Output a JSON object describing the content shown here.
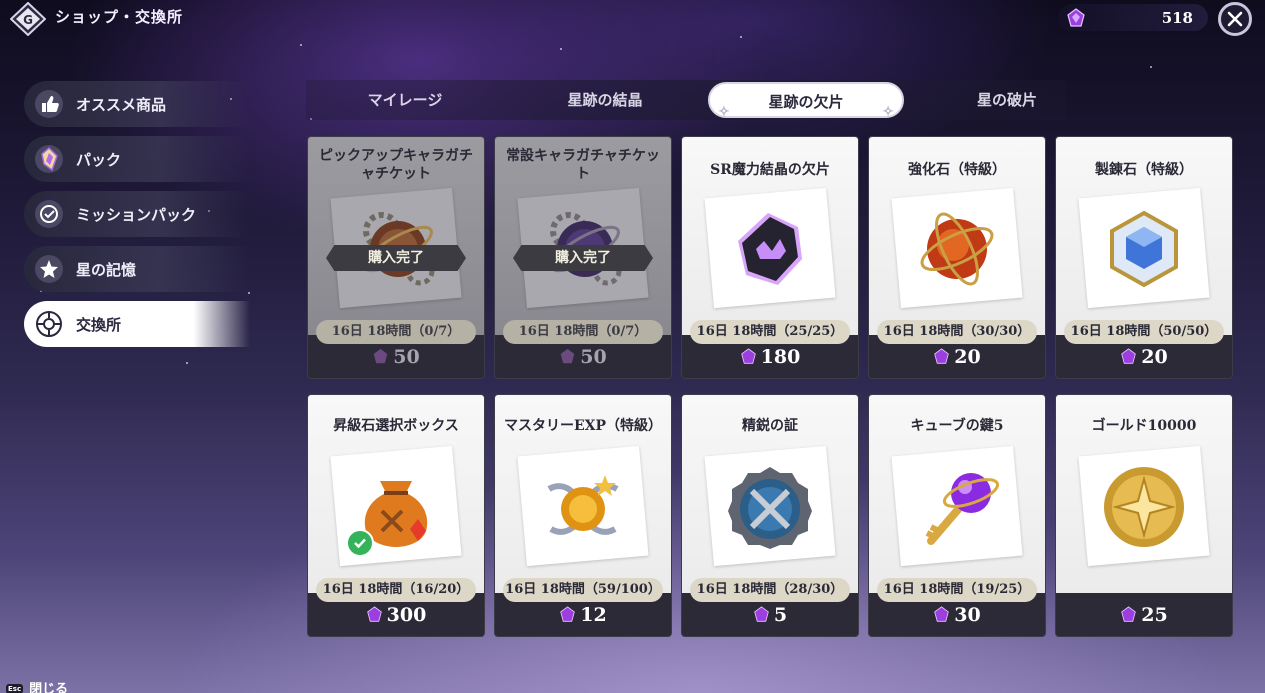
{
  "header": {
    "title": "ショップ・交換所",
    "currency_amount": "518",
    "currency_icon": "crystal-shard-icon"
  },
  "sidebar": {
    "items": [
      {
        "label": "オススメ商品",
        "icon": "thumbs-up-icon"
      },
      {
        "label": "パック",
        "icon": "crystal-pack-icon"
      },
      {
        "label": "ミッションパック",
        "icon": "mission-icon"
      },
      {
        "label": "星の記憶",
        "icon": "star-memory-icon"
      },
      {
        "label": "交換所",
        "icon": "exchange-icon"
      }
    ]
  },
  "tabs": [
    {
      "label": "マイレージ"
    },
    {
      "label": "星跡の結晶"
    },
    {
      "label": "星跡の欠片"
    },
    {
      "label": "星の破片"
    }
  ],
  "shop": {
    "sold_label": "購入完了",
    "items": [
      {
        "name": "ピックアップキャラガチャチケット",
        "timer": "16日 18時間（0/7）",
        "price": "50",
        "icon": "pickup-ticket-icon",
        "sold": true
      },
      {
        "name": "常設キャラガチャチケット",
        "timer": "16日 18時間（0/7）",
        "price": "50",
        "icon": "standard-ticket-icon",
        "sold": true
      },
      {
        "name": "SR魔力結晶の欠片",
        "timer": "16日 18時間（25/25）",
        "price": "180",
        "icon": "sr-crystal-fragment-icon",
        "sold": false
      },
      {
        "name": "強化石（特級）",
        "timer": "16日 18時間（30/30）",
        "price": "20",
        "icon": "enhance-stone-icon",
        "sold": false
      },
      {
        "name": "製錬石（特級）",
        "timer": "16日 18時間（50/50）",
        "price": "20",
        "icon": "refine-stone-icon",
        "sold": false
      },
      {
        "name": "昇級石選択ボックス",
        "timer": "16日 18時間（16/20）",
        "price": "300",
        "icon": "upgrade-bag-icon",
        "sold": false
      },
      {
        "name": "マスタリーEXP（特級）",
        "timer": "16日 18時間（59/100）",
        "price": "12",
        "icon": "mastery-exp-icon",
        "sold": false
      },
      {
        "name": "精鋭の証",
        "timer": "16日 18時間（28/30）",
        "price": "5",
        "icon": "elite-medal-icon",
        "sold": false
      },
      {
        "name": "キューブの鍵5",
        "timer": "16日 18時間（19/25）",
        "price": "30",
        "icon": "cube-key-icon",
        "sold": false
      },
      {
        "name": "ゴールド10000",
        "timer": "",
        "price": "25",
        "icon": "gold-coin-icon",
        "sold": false
      }
    ]
  },
  "footer": {
    "esc_key": "Esc",
    "close_label": "閉じる"
  },
  "colors": {
    "accent": "#8b2bd9",
    "sold_overlay": "#3d3b42",
    "timer_bg": "#ddd7c8",
    "check": "#34b35a"
  }
}
